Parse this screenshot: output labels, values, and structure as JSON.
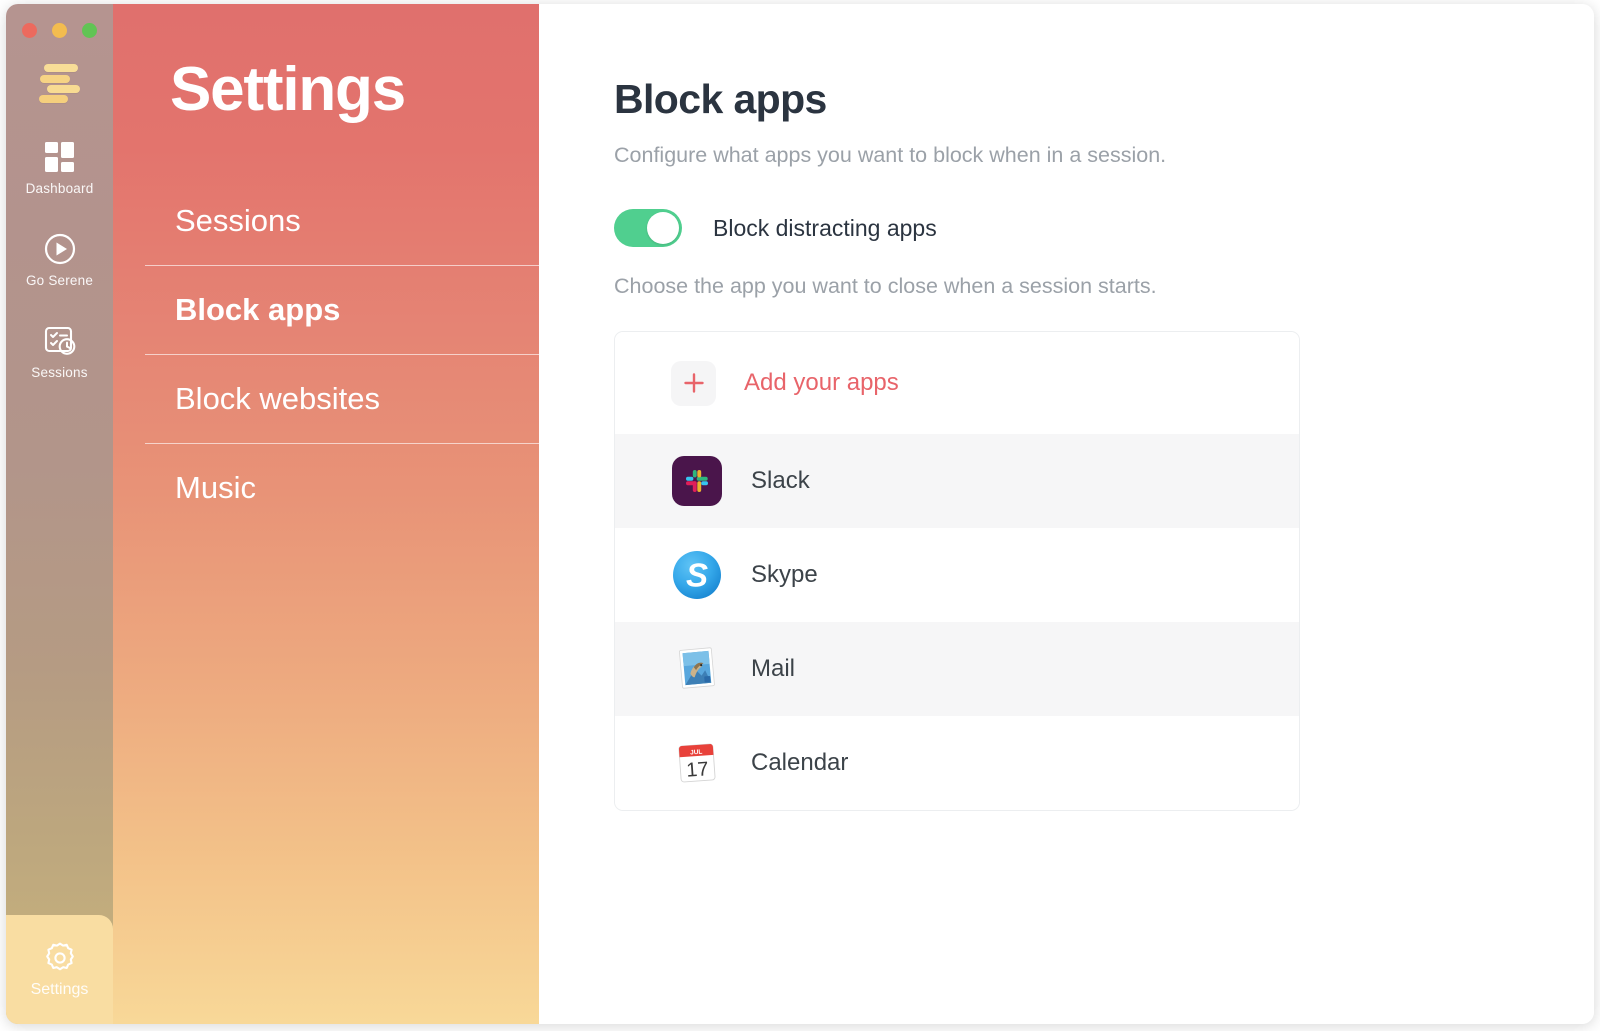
{
  "window": {
    "traffic_lights": [
      {
        "name": "close",
        "color": "#ec6a5e"
      },
      {
        "name": "minimize",
        "color": "#f3bc4f"
      },
      {
        "name": "maximize",
        "color": "#61c454"
      }
    ]
  },
  "rail": {
    "logo_icon": "serene-logo-icon",
    "items": [
      {
        "label": "Dashboard",
        "icon": "dashboard-grid-icon",
        "active": false
      },
      {
        "label": "Go Serene",
        "icon": "play-circle-icon",
        "active": false
      },
      {
        "label": "Sessions",
        "icon": "checklist-clock-icon",
        "active": false
      }
    ],
    "bottom_item": {
      "label": "Settings",
      "icon": "gear-icon",
      "active": true
    }
  },
  "settings": {
    "title": "Settings",
    "menu": [
      {
        "label": "Sessions",
        "active": false
      },
      {
        "label": "Block apps",
        "active": true
      },
      {
        "label": "Block websites",
        "active": false
      },
      {
        "label": "Music",
        "active": false
      }
    ]
  },
  "main": {
    "title": "Block apps",
    "subtitle": "Configure what apps you want to block when in a session.",
    "toggle": {
      "label": "Block distracting apps",
      "enabled": true,
      "on_color": "#50cf8f"
    },
    "hint": "Choose the app you want to close when a session starts.",
    "add_row": {
      "label": "Add your apps",
      "icon": "plus-icon",
      "accent_color": "#e8646a"
    },
    "apps": [
      {
        "name": "Slack",
        "icon": "slack-icon",
        "shaded": true
      },
      {
        "name": "Skype",
        "icon": "skype-icon",
        "shaded": false
      },
      {
        "name": "Mail",
        "icon": "mail-icon",
        "shaded": true
      },
      {
        "name": "Calendar",
        "icon": "calendar-icon",
        "shaded": false,
        "calendar_month": "JUL",
        "calendar_day": "17"
      }
    ]
  }
}
